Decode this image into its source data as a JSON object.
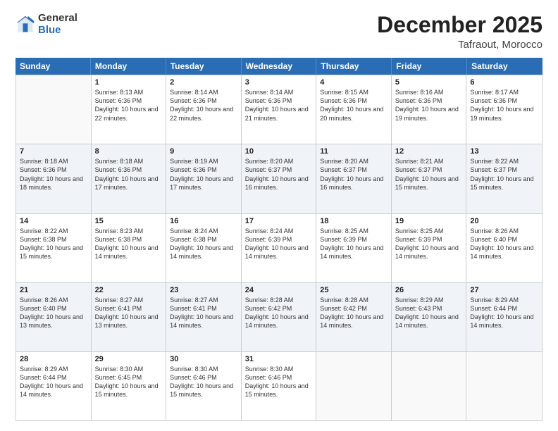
{
  "logo": {
    "general": "General",
    "blue": "Blue"
  },
  "header": {
    "month": "December 2025",
    "location": "Tafraout, Morocco"
  },
  "weekdays": [
    "Sunday",
    "Monday",
    "Tuesday",
    "Wednesday",
    "Thursday",
    "Friday",
    "Saturday"
  ],
  "rows": [
    [
      {
        "day": "",
        "info": ""
      },
      {
        "day": "1",
        "info": "Sunrise: 8:13 AM\nSunset: 6:36 PM\nDaylight: 10 hours\nand 22 minutes."
      },
      {
        "day": "2",
        "info": "Sunrise: 8:14 AM\nSunset: 6:36 PM\nDaylight: 10 hours\nand 22 minutes."
      },
      {
        "day": "3",
        "info": "Sunrise: 8:14 AM\nSunset: 6:36 PM\nDaylight: 10 hours\nand 21 minutes."
      },
      {
        "day": "4",
        "info": "Sunrise: 8:15 AM\nSunset: 6:36 PM\nDaylight: 10 hours\nand 20 minutes."
      },
      {
        "day": "5",
        "info": "Sunrise: 8:16 AM\nSunset: 6:36 PM\nDaylight: 10 hours\nand 19 minutes."
      },
      {
        "day": "6",
        "info": "Sunrise: 8:17 AM\nSunset: 6:36 PM\nDaylight: 10 hours\nand 19 minutes."
      }
    ],
    [
      {
        "day": "7",
        "info": "Sunrise: 8:18 AM\nSunset: 6:36 PM\nDaylight: 10 hours\nand 18 minutes."
      },
      {
        "day": "8",
        "info": "Sunrise: 8:18 AM\nSunset: 6:36 PM\nDaylight: 10 hours\nand 17 minutes."
      },
      {
        "day": "9",
        "info": "Sunrise: 8:19 AM\nSunset: 6:36 PM\nDaylight: 10 hours\nand 17 minutes."
      },
      {
        "day": "10",
        "info": "Sunrise: 8:20 AM\nSunset: 6:37 PM\nDaylight: 10 hours\nand 16 minutes."
      },
      {
        "day": "11",
        "info": "Sunrise: 8:20 AM\nSunset: 6:37 PM\nDaylight: 10 hours\nand 16 minutes."
      },
      {
        "day": "12",
        "info": "Sunrise: 8:21 AM\nSunset: 6:37 PM\nDaylight: 10 hours\nand 15 minutes."
      },
      {
        "day": "13",
        "info": "Sunrise: 8:22 AM\nSunset: 6:37 PM\nDaylight: 10 hours\nand 15 minutes."
      }
    ],
    [
      {
        "day": "14",
        "info": "Sunrise: 8:22 AM\nSunset: 6:38 PM\nDaylight: 10 hours\nand 15 minutes."
      },
      {
        "day": "15",
        "info": "Sunrise: 8:23 AM\nSunset: 6:38 PM\nDaylight: 10 hours\nand 14 minutes."
      },
      {
        "day": "16",
        "info": "Sunrise: 8:24 AM\nSunset: 6:38 PM\nDaylight: 10 hours\nand 14 minutes."
      },
      {
        "day": "17",
        "info": "Sunrise: 8:24 AM\nSunset: 6:39 PM\nDaylight: 10 hours\nand 14 minutes."
      },
      {
        "day": "18",
        "info": "Sunrise: 8:25 AM\nSunset: 6:39 PM\nDaylight: 10 hours\nand 14 minutes."
      },
      {
        "day": "19",
        "info": "Sunrise: 8:25 AM\nSunset: 6:39 PM\nDaylight: 10 hours\nand 14 minutes."
      },
      {
        "day": "20",
        "info": "Sunrise: 8:26 AM\nSunset: 6:40 PM\nDaylight: 10 hours\nand 14 minutes."
      }
    ],
    [
      {
        "day": "21",
        "info": "Sunrise: 8:26 AM\nSunset: 6:40 PM\nDaylight: 10 hours\nand 13 minutes."
      },
      {
        "day": "22",
        "info": "Sunrise: 8:27 AM\nSunset: 6:41 PM\nDaylight: 10 hours\nand 13 minutes."
      },
      {
        "day": "23",
        "info": "Sunrise: 8:27 AM\nSunset: 6:41 PM\nDaylight: 10 hours\nand 14 minutes."
      },
      {
        "day": "24",
        "info": "Sunrise: 8:28 AM\nSunset: 6:42 PM\nDaylight: 10 hours\nand 14 minutes."
      },
      {
        "day": "25",
        "info": "Sunrise: 8:28 AM\nSunset: 6:42 PM\nDaylight: 10 hours\nand 14 minutes."
      },
      {
        "day": "26",
        "info": "Sunrise: 8:29 AM\nSunset: 6:43 PM\nDaylight: 10 hours\nand 14 minutes."
      },
      {
        "day": "27",
        "info": "Sunrise: 8:29 AM\nSunset: 6:44 PM\nDaylight: 10 hours\nand 14 minutes."
      }
    ],
    [
      {
        "day": "28",
        "info": "Sunrise: 8:29 AM\nSunset: 6:44 PM\nDaylight: 10 hours\nand 14 minutes."
      },
      {
        "day": "29",
        "info": "Sunrise: 8:30 AM\nSunset: 6:45 PM\nDaylight: 10 hours\nand 15 minutes."
      },
      {
        "day": "30",
        "info": "Sunrise: 8:30 AM\nSunset: 6:46 PM\nDaylight: 10 hours\nand 15 minutes."
      },
      {
        "day": "31",
        "info": "Sunrise: 8:30 AM\nSunset: 6:46 PM\nDaylight: 10 hours\nand 15 minutes."
      },
      {
        "day": "",
        "info": ""
      },
      {
        "day": "",
        "info": ""
      },
      {
        "day": "",
        "info": ""
      }
    ]
  ]
}
